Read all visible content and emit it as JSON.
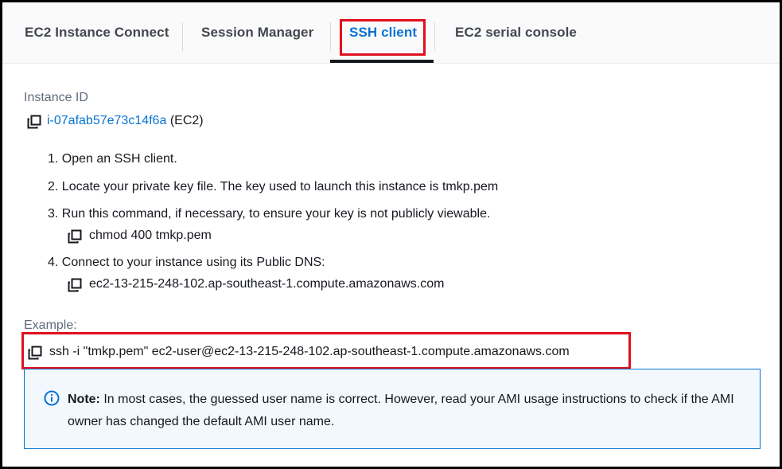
{
  "tabs": [
    {
      "label": "EC2 Instance Connect",
      "active": false
    },
    {
      "label": "Session Manager",
      "active": false
    },
    {
      "label": "SSH client",
      "active": true
    },
    {
      "label": "EC2 serial console",
      "active": false
    }
  ],
  "instance": {
    "label": "Instance ID",
    "id": "i-07afab57e73c14f6a",
    "suffix": "(EC2)"
  },
  "steps": [
    {
      "text": "1. Open an SSH client."
    },
    {
      "text": "2. Locate your private key file. The key used to launch this instance is tmkp.pem"
    },
    {
      "text": "3. Run this command, if necessary, to ensure your key is not publicly viewable.",
      "command": "chmod 400 tmkp.pem"
    },
    {
      "text": "4. Connect to your instance using its Public DNS:",
      "command": "ec2-13-215-248-102.ap-southeast-1.compute.amazonaws.com"
    }
  ],
  "example": {
    "label": "Example:",
    "command": "ssh -i \"tmkp.pem\" ec2-user@ec2-13-215-248-102.ap-southeast-1.compute.amazonaws.com"
  },
  "note": {
    "title": "Note:",
    "text": " In most cases, the guessed user name is correct. However, read your AMI usage instructions to check if the AMI owner has changed the default AMI user name."
  },
  "colors": {
    "link": "#0972d3",
    "highlight": "#e0101e",
    "info_border": "#0972d3",
    "info_bg": "#f2f8fd"
  },
  "icons": [
    "copy-icon",
    "info-icon"
  ]
}
